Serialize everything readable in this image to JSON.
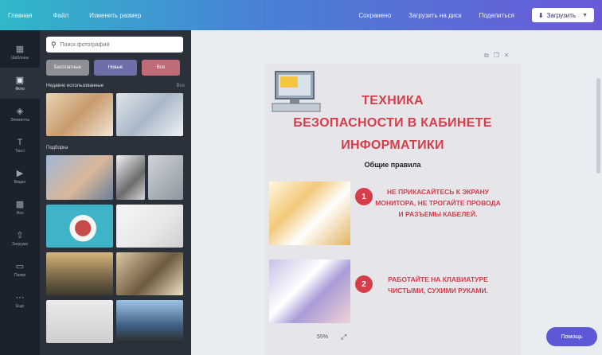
{
  "topbar": {
    "items": [
      "Главная",
      "Файл",
      "Изменить размер"
    ],
    "right_items": [
      "Сохранено",
      "Загрузить на диск",
      "Поделиться"
    ],
    "account_label": "Загрузить"
  },
  "rail": {
    "items": [
      {
        "label": "Шаблоны",
        "icon": "template-icon"
      },
      {
        "label": "Фото",
        "icon": "photo-icon"
      },
      {
        "label": "Элементы",
        "icon": "elements-icon"
      },
      {
        "label": "Текст",
        "icon": "text-icon"
      },
      {
        "label": "Видео",
        "icon": "video-icon"
      },
      {
        "label": "Фон",
        "icon": "background-icon"
      },
      {
        "label": "Загрузки",
        "icon": "upload-icon"
      },
      {
        "label": "Папки",
        "icon": "folder-icon"
      },
      {
        "label": "Ещё",
        "icon": "more-icon"
      }
    ]
  },
  "panel": {
    "search_placeholder": "Поиск фотографий",
    "chips": [
      "Бесплатные",
      "Новые",
      "Все"
    ],
    "section1_title": "Недавно использованные",
    "section1_more": "Все",
    "section2_title": "Подборка"
  },
  "design": {
    "title_lines": [
      "ТЕХНИКА",
      "БЕЗОПАСНОСТИ В КАБИНЕТЕ",
      "ИНФОРМАТИКИ"
    ],
    "subtitle": "Общие правила",
    "rules": [
      {
        "num": "1",
        "text": "НЕ ПРИКАСАЙТЕСЬ К ЭКРАНУ МОНИТОРА, НЕ ТРОГАЙТЕ ПРОВОДА И РАЗЪЕМЫ КАБЕЛЕЙ."
      },
      {
        "num": "2",
        "text": "РАБОТАЙТЕ НА КЛАВИАТУРЕ ЧИСТЫМИ, СУХИМИ РУКАМИ."
      }
    ]
  },
  "footer": {
    "zoom": "55%",
    "help_label": "Помощь"
  },
  "colors": {
    "accent_red": "#d63d4a",
    "help_purple": "#5d59d6",
    "panel_dark": "#2a313b"
  }
}
